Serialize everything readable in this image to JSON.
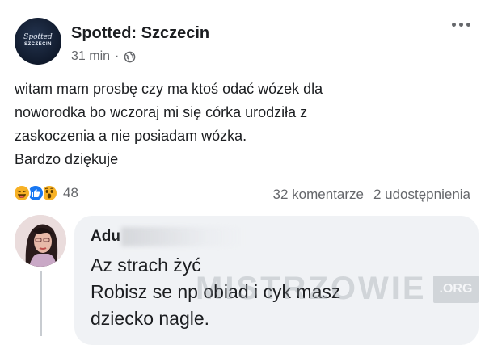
{
  "post": {
    "page_name": "Spotted: Szczecin",
    "time": "31 min",
    "separator": "·",
    "avatar_logo_script": "Spotted",
    "avatar_logo_city": "SZCZECIN",
    "body_lines": [
      "witam mam prosbę czy ma ktoś odać wózek dla",
      "noworodka bo wczoraj mi się córka urodziła z",
      "zaskoczenia a nie posiadam wózka.",
      "Bardzo dziękuje"
    ],
    "reactions": {
      "icons": [
        "haha-reaction-icon",
        "like-reaction-icon",
        "wow-reaction-icon"
      ],
      "count": "48"
    },
    "comments_count": "32 komentarze",
    "shares_count": "2 udostępnienia"
  },
  "comment": {
    "author_visible": "Adu",
    "lines": [
      "Az strach żyć",
      "Robisz se np obiad i cyk masz",
      "dziecko nagle."
    ]
  },
  "watermark": {
    "text": "MISTRZOWIE",
    "badge": ".ORG"
  },
  "colors": {
    "meta_gray": "#65676b",
    "like_blue": "#1877f2",
    "reaction_yellow": "#f7b125",
    "bubble_bg": "#f0f2f5"
  }
}
